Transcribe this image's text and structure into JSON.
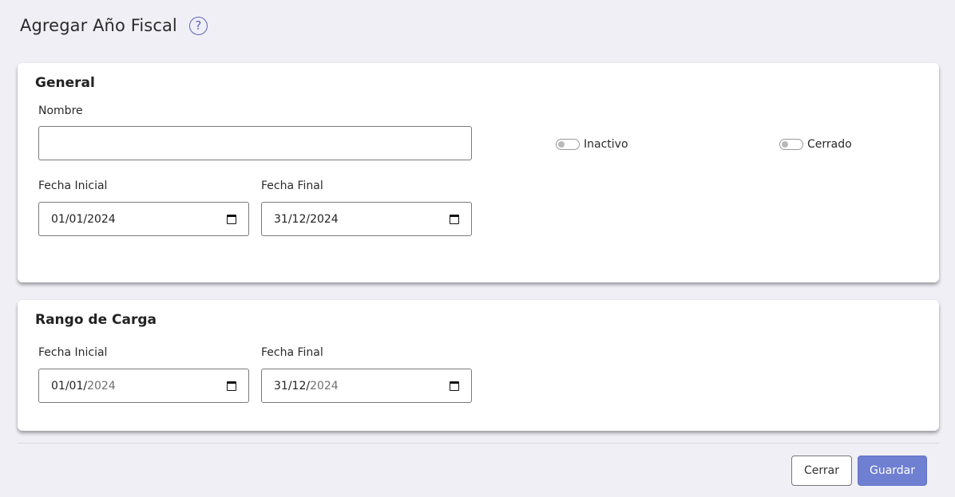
{
  "header": {
    "title": "Agregar Año Fiscal",
    "help_glyph": "?"
  },
  "general": {
    "title": "General",
    "nombre_label": "Nombre",
    "nombre_value": "",
    "inactivo_label": "Inactivo",
    "inactivo_on": false,
    "cerrado_label": "Cerrado",
    "cerrado_on": false,
    "fecha_inicial_label": "Fecha Inicial",
    "fecha_inicial_value": "01/01/2024",
    "fecha_final_label": "Fecha Final",
    "fecha_final_value": "31/12/2024"
  },
  "rango": {
    "title": "Rango de Carga",
    "fecha_inicial_label": "Fecha Inicial",
    "fecha_inicial_day_month": "01/01/",
    "fecha_inicial_year": "2024",
    "fecha_final_label": "Fecha Final",
    "fecha_final_day_month": "31/12/",
    "fecha_final_year": "2024"
  },
  "footer": {
    "cerrar_label": "Cerrar",
    "guardar_label": "Guardar"
  },
  "colors": {
    "background": "#f0eff6",
    "primary": "#6f7fd2",
    "help_icon": "#5b63b5"
  },
  "icons": [
    "help-icon",
    "calendar-icon"
  ]
}
